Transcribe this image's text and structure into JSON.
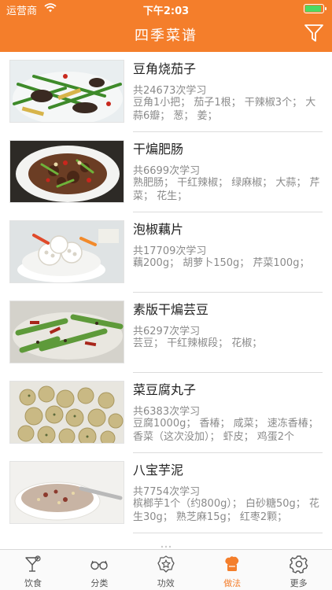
{
  "status": {
    "carrier": "运营商",
    "time": "下午2:03"
  },
  "header": {
    "title": "四季菜谱"
  },
  "recipes": [
    {
      "name": "豆角烧茄子",
      "count": "共24673次学习",
      "ingredients": "豆角1小把； 茄子1根； 干辣椒3个； 大蒜6瓣； 葱； 姜；"
    },
    {
      "name": "干煸肥肠",
      "count": "共6699次学习",
      "ingredients": "熟肥肠； 干红辣椒； 绿麻椒； 大蒜； 芹菜； 花生；"
    },
    {
      "name": "泡椒藕片",
      "count": "共17709次学习",
      "ingredients": "藕200g； 胡萝卜150g； 芹菜100g；"
    },
    {
      "name": "素版干煸芸豆",
      "count": "共6297次学习",
      "ingredients": "芸豆； 干红辣椒段； 花椒；"
    },
    {
      "name": "菜豆腐丸子",
      "count": "共6383次学习",
      "ingredients": "豆腐1000g； 香椿； 咸菜； 速冻香椿； 香菜（这次没加）； 虾皮； 鸡蛋2个"
    },
    {
      "name": "八宝芋泥",
      "count": "共7754次学习",
      "ingredients": "槟榔芋1个（约800g）； 白砂糖50g； 花生30g； 熟芝麻15g； 红枣2颗；"
    }
  ],
  "tabs": [
    {
      "label": "饮食",
      "icon": "cocktail-icon"
    },
    {
      "label": "分类",
      "icon": "glasses-icon"
    },
    {
      "label": "功效",
      "icon": "star-badge-icon"
    },
    {
      "label": "做法",
      "icon": "chef-hat-icon",
      "active": true
    },
    {
      "label": "更多",
      "icon": "gear-icon"
    }
  ],
  "colors": {
    "accent": "#f47e2b",
    "muted_text": "#8a8a8a"
  }
}
